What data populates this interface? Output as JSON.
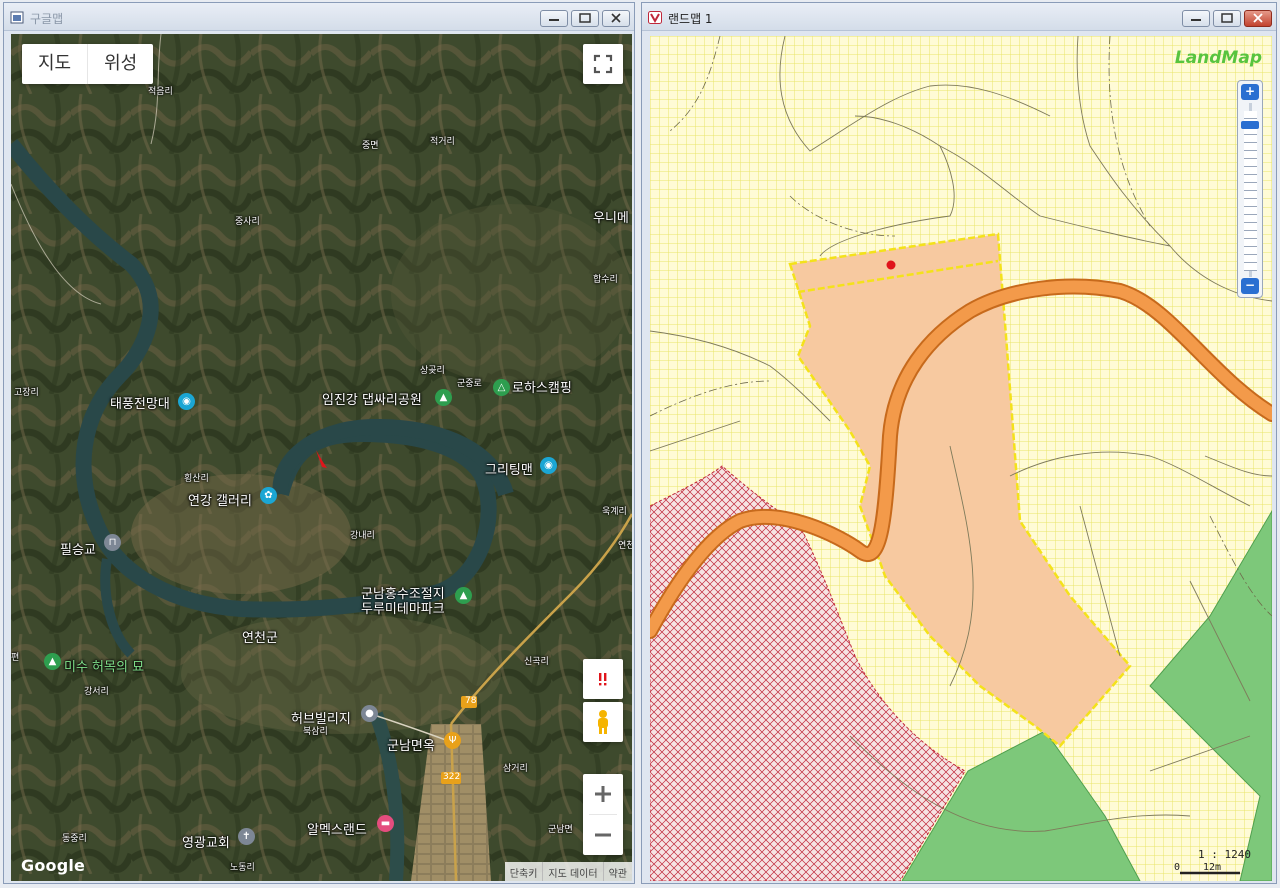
{
  "left_window": {
    "title": "구글맵",
    "toggle": {
      "map": "지도",
      "satellite": "위성"
    },
    "labels_small": {
      "jeokeum": "적음리",
      "jungmyeon": "중면",
      "jeokgeo": "적거리",
      "jungsa": "중사리",
      "hapsu": "합수리",
      "gojang": "고장리",
      "sanggot": "상곶리",
      "gunjung": "군중로",
      "hoengsan": "횡산리",
      "gangnae": "강내리",
      "sinsu": "신곡리",
      "gangseo": "강서리",
      "buksam": "북삼리",
      "samgeo": "삼거리",
      "dongjung": "동중리",
      "nodong": "노동리",
      "gunnam_road": "군남면",
      "ukgye": "욱계리",
      "yeonbuk": "연천",
      "pyeon": "편"
    },
    "labels_main": {
      "taepung": "태풍전망대",
      "imjingang": "임진강 댑싸리공원",
      "rohas": "로하스캠핑",
      "uni": "우니메",
      "gritingmaen": "그리팅맨",
      "yeongang": "연강 갤러리",
      "pilseunggyo": "필승교",
      "gunnam_park_1": "군남홍수조절지",
      "gunnam_park_2": "두루미테마파크",
      "yeoncheongun": "연천군",
      "misu": "미수 허목의 묘",
      "herb": "허브빌리지",
      "gunnam_food": "군남면옥",
      "alpex": "알멕스랜드",
      "yeonggwang": "영광교회"
    },
    "road_numbers": {
      "r78": "78",
      "r322": "322"
    },
    "google": "Google",
    "attribution": [
      "단축키",
      "지도 데이터",
      "약관"
    ]
  },
  "right_window": {
    "title": "랜드맵 1",
    "logo": "LandMap",
    "scale_text": "1 : 1240",
    "scalebar": {
      "zero": "0",
      "dist": "12m"
    }
  },
  "colors": {
    "parcel_fill": "#f7c9a0",
    "parcel_border": "#f4e21a",
    "road": "#f08c3a",
    "forest": "#7dc87a",
    "red_hatch": "#c0283a",
    "grid": "#e5e26a",
    "marker": "#e0141b"
  }
}
